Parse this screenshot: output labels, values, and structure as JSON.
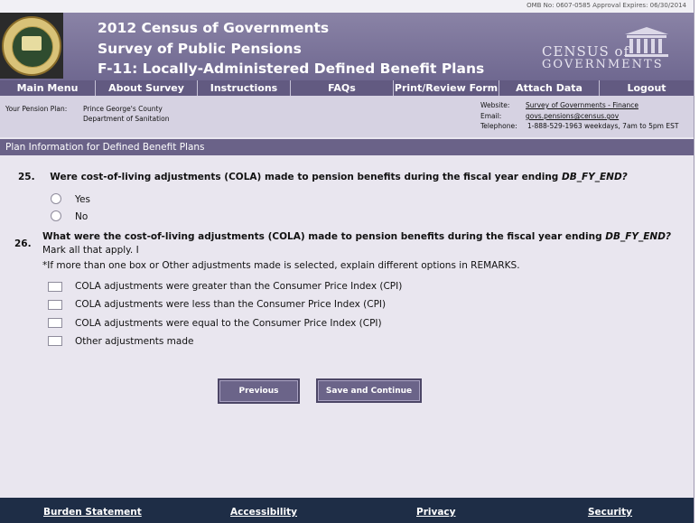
{
  "omb": {
    "text": "OMB No:  0607-0585  Approval Expires:  06/30/2014"
  },
  "header": {
    "title_line1": "2012 Census of Governments",
    "title_line2": "Survey of Public Pensions",
    "title_line3": "F-11:  Locally-Administered Defined Benefit Plans",
    "logo_line1": "CENSUS of",
    "logo_line2": "GOVERNMENTS"
  },
  "nav": {
    "items": [
      {
        "label": "Main Menu"
      },
      {
        "label": "About Survey"
      },
      {
        "label": "Instructions"
      },
      {
        "label": "FAQs"
      },
      {
        "label": "Print/Review Form"
      },
      {
        "label": "Attach Data"
      },
      {
        "label": "Logout"
      }
    ]
  },
  "info": {
    "plan_label": "Your Pension Plan:",
    "plan_line1": "Prince George's County",
    "plan_line2": "Department of Sanitation",
    "website_label": "Website:",
    "website_value": "Survey of Governments - Finance",
    "email_label": "Email:",
    "email_value": "govs.pensions@census.gov",
    "telephone_label": "Telephone:",
    "telephone_value": "1-888-529-1963  weekdays, 7am to 5pm EST"
  },
  "section": {
    "title": "Plan Information for Defined Benefit Plans"
  },
  "q25": {
    "number": "25.",
    "text": "Were cost-of-living adjustments (COLA) made to pension benefits during the fiscal year ending ",
    "variable": "DB_FY_END?",
    "options": [
      "Yes",
      "No"
    ]
  },
  "q26": {
    "number": "26.",
    "text": "What were the cost-of-living adjustments (COLA) made to pension benefits during the fiscal year ending ",
    "variable": "DB_FY_END?",
    "instruction1": "Mark all that apply. I",
    "instruction2": "*If more than one box or Other adjustments made is selected, explain different options in REMARKS.",
    "options": [
      "COLA adjustments were greater than the Consumer Price Index (CPI)",
      "COLA adjustments were less than the Consumer Price Index (CPI)",
      "COLA adjustments were equal to the Consumer Price Index (CPI)",
      "Other adjustments made"
    ]
  },
  "buttons": {
    "previous": "Previous",
    "save_continue": "Save and Continue"
  },
  "footer": {
    "links": [
      "Burden Statement",
      "Accessibility",
      "Privacy",
      "Security"
    ]
  },
  "colors": {
    "header": "#7a7396",
    "nav": "#625a81",
    "section_bar": "#6a6288",
    "body": "#e9e6ef",
    "footer": "#1e2d46"
  }
}
